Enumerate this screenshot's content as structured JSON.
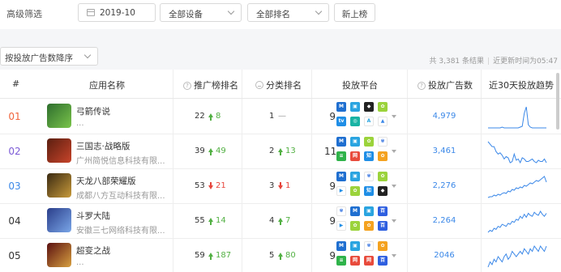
{
  "filter": {
    "label": "高级筛选",
    "date_value": "2019-10",
    "device_value": "全部设备",
    "rank_value": "全部排名",
    "new_button": "新上榜"
  },
  "sort": {
    "value": "按投放广告数降序",
    "total": "共 3,381 条结果",
    "updated": "近更新时间为05:47"
  },
  "columns": {
    "rank": "#",
    "app": "应用名称",
    "promo_rank": "推广榜排名",
    "cat_rank": "分类排名",
    "platform": "投放平台",
    "ad_count": "投放广告数",
    "trend": "近30天投放趋势"
  },
  "colors": {
    "accent": "#3b88e8",
    "up": "#52b043",
    "down": "#e6453c",
    "rank_top": "#f0643c",
    "rank_second": "#7c5bd6"
  },
  "rows": [
    {
      "rank": "01",
      "name": "弓箭传说",
      "developer": "...",
      "promo": "22",
      "promo_change": "8",
      "promo_dir": "up",
      "cat": "1",
      "cat_change": "—",
      "cat_dir": "flat",
      "platform_count": "9",
      "platforms": [
        "ms-icon",
        "cube-icon",
        "unity-icon",
        "flower-icon",
        "tv-icon",
        "teal-icon",
        "a-icon",
        "tri-icon"
      ],
      "ads": "4,979",
      "trend": [
        2,
        2,
        2,
        2,
        2,
        2,
        2,
        3,
        2,
        2,
        2,
        2,
        2,
        2,
        2,
        2,
        3,
        4,
        20,
        28,
        6,
        3,
        2,
        2,
        2,
        2,
        2,
        2,
        2,
        2
      ]
    },
    {
      "rank": "02",
      "name": "三国志·战略版",
      "developer": "广州简悦信息科技有限...",
      "promo": "39",
      "promo_change": "49",
      "promo_dir": "up",
      "cat": "2",
      "cat_change": "13",
      "cat_dir": "up",
      "platform_count": "11",
      "platforms": [
        "ms-icon",
        "cube-icon",
        "flower-icon",
        "paw-icon",
        "green-icon",
        "red-icon",
        "zhi-icon",
        "orange-icon"
      ],
      "ads": "3,461",
      "trend": [
        26,
        24,
        22,
        22,
        18,
        16,
        17,
        15,
        12,
        14,
        13,
        9,
        10,
        16,
        11,
        12,
        9,
        13,
        12,
        10,
        10,
        11,
        12,
        10,
        9,
        11,
        10,
        10,
        12,
        9
      ]
    },
    {
      "rank": "03",
      "name": "天龙八部荣耀版",
      "developer": "成都八方互动科技有限...",
      "promo": "53",
      "promo_change": "21",
      "promo_dir": "down",
      "cat": "3",
      "cat_change": "1",
      "cat_dir": "down",
      "platform_count": "9",
      "platforms": [
        "ms-icon",
        "cube-icon",
        "paw-icon",
        "flower-icon",
        "play-icon",
        "flower-icon",
        "zhi-icon",
        "unity-icon"
      ],
      "ads": "2,276",
      "trend": [
        3,
        4,
        4,
        6,
        5,
        7,
        6,
        8,
        9,
        8,
        11,
        10,
        13,
        12,
        15,
        14,
        16,
        15,
        18,
        17,
        19,
        21,
        20,
        22,
        24,
        23,
        25,
        27,
        29,
        22
      ]
    },
    {
      "rank": "04",
      "name": "斗罗大陆",
      "developer": "安徽三七网络科技有限...",
      "promo": "55",
      "promo_change": "14",
      "promo_dir": "up",
      "cat": "4",
      "cat_change": "7",
      "cat_dir": "up",
      "platform_count": "9",
      "platforms": [
        "paw-icon",
        "ms-icon",
        "cube-icon",
        "baidu-icon",
        "play-icon",
        "flower-icon",
        "orange-icon",
        "baidu-icon"
      ],
      "ads": "2,264",
      "trend": [
        6,
        8,
        7,
        10,
        9,
        12,
        11,
        14,
        13,
        12,
        15,
        14,
        17,
        16,
        19,
        18,
        22,
        20,
        24,
        21,
        25,
        23,
        22,
        26,
        24,
        23,
        27,
        24,
        22,
        25
      ]
    },
    {
      "rank": "05",
      "name": "超变之战",
      "developer": "...",
      "promo": "59",
      "promo_change": "187",
      "promo_dir": "up",
      "cat": "5",
      "cat_change": "80",
      "cat_dir": "up",
      "platform_count": "9",
      "platforms": [
        "ms-icon",
        "cube-icon",
        "paw-icon",
        "orange-icon",
        "green-icon",
        "red-icon",
        "red-icon",
        "baidu-icon"
      ],
      "ads": "2046",
      "trend": [
        10,
        12,
        11,
        13,
        12,
        14,
        13,
        12,
        14,
        15,
        13,
        14,
        16,
        15,
        14,
        15,
        16,
        15,
        17,
        16,
        15,
        17,
        16,
        18,
        17,
        16,
        18,
        17,
        16,
        18
      ]
    }
  ]
}
